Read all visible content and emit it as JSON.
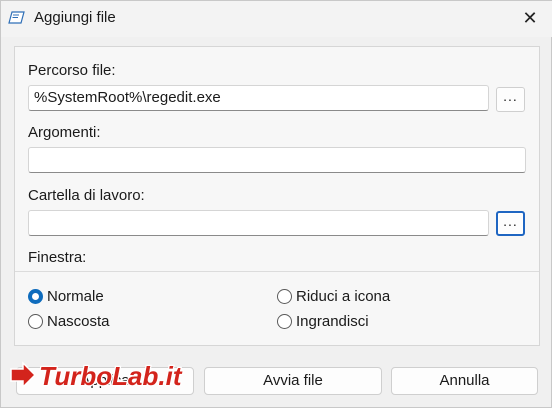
{
  "window": {
    "title": "Aggiungi file",
    "close_glyph": "✕"
  },
  "form": {
    "path_label": "Percorso file:",
    "path_value": "%SystemRoot%\\regedit.exe",
    "path_browse": "...",
    "args_label": "Argomenti:",
    "args_value": "",
    "workdir_label": "Cartella di lavoro:",
    "workdir_value": "",
    "workdir_browse": "..."
  },
  "window_mode": {
    "label": "Finestra:",
    "options": [
      {
        "label": "Normale",
        "selected": true
      },
      {
        "label": "Riduci a icona",
        "selected": false
      },
      {
        "label": "Nascosta",
        "selected": false
      },
      {
        "label": "Ingrandisci",
        "selected": false
      }
    ]
  },
  "buttons": {
    "apply": "Applica",
    "run": "Avvia file",
    "cancel": "Annulla"
  },
  "watermark": {
    "text": "TurboLab.it"
  },
  "colors": {
    "accent": "#0f6cbd",
    "focus": "#1f66c2",
    "watermark_red": "#d3241c",
    "background": "#f0f0f0"
  },
  "icons": {
    "app": "app-shortcut-icon",
    "close": "close-icon"
  }
}
